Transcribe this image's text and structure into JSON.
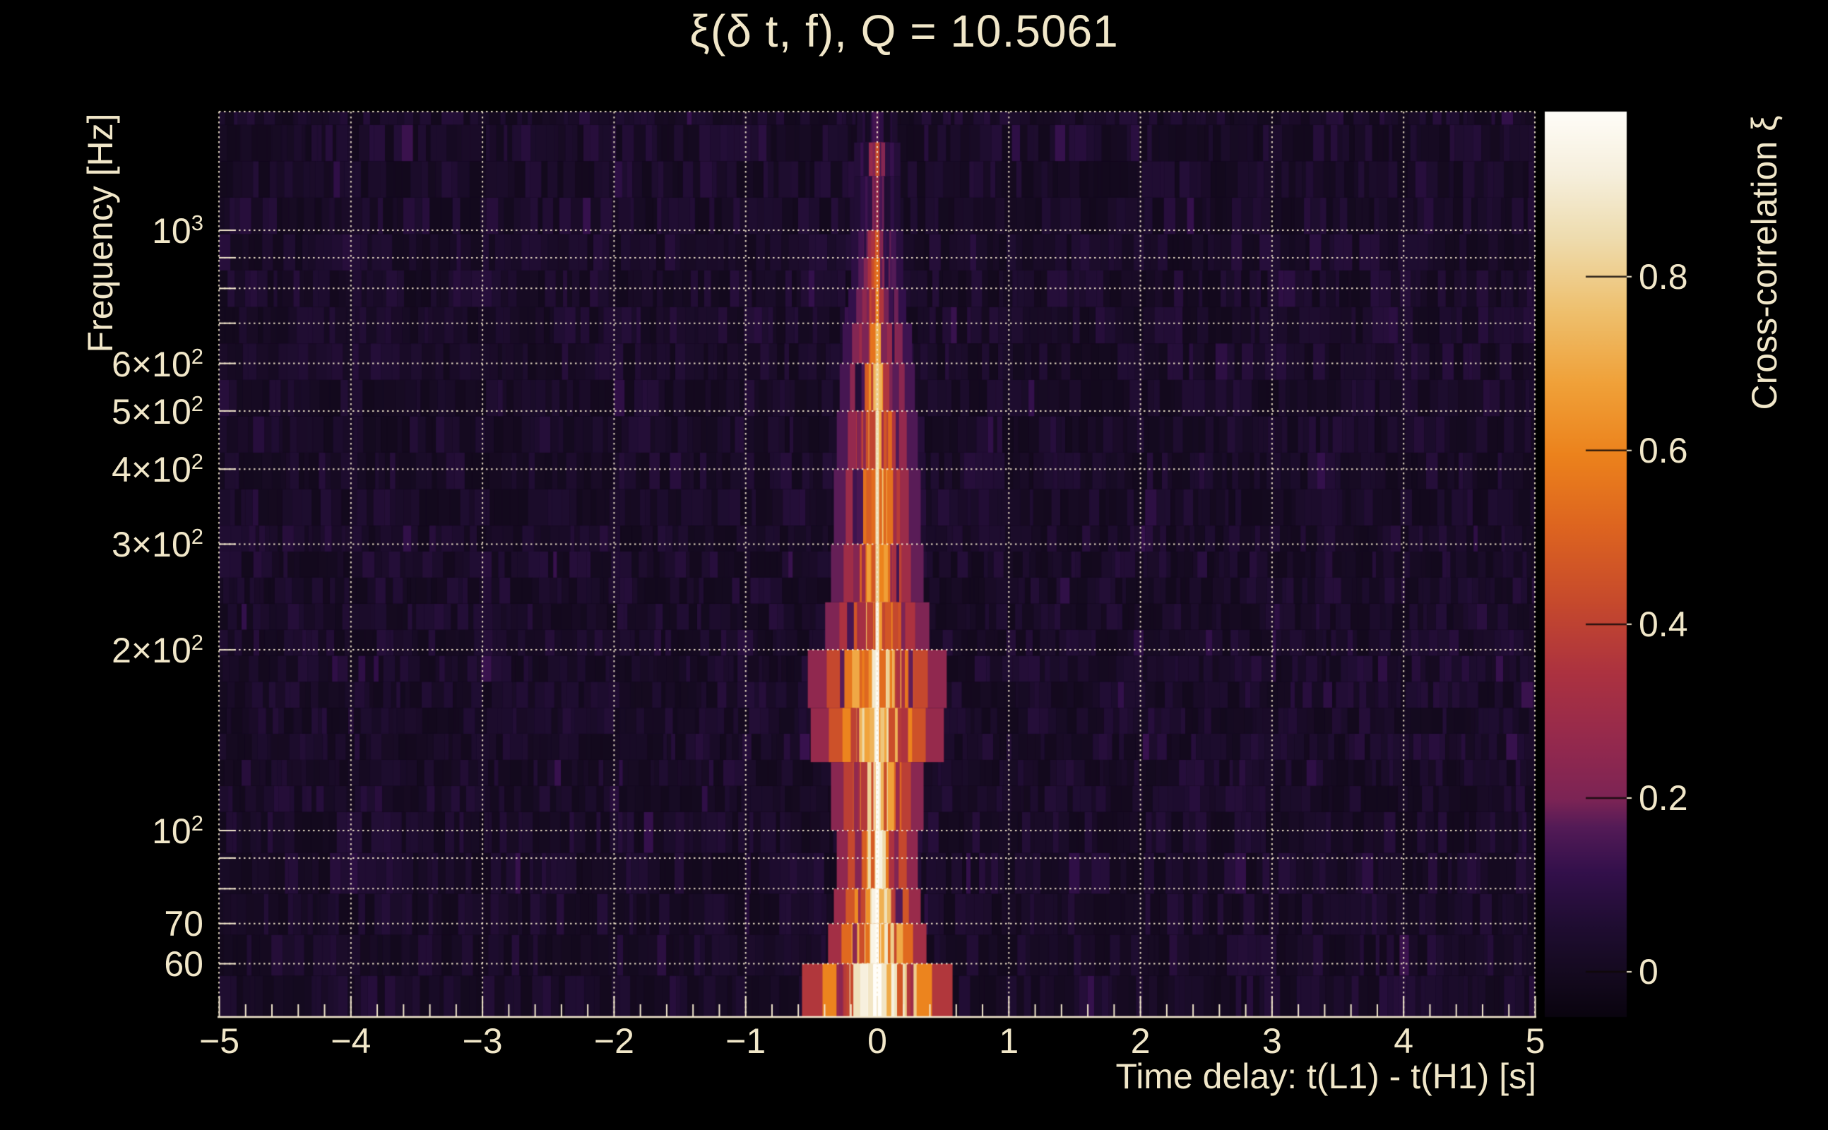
{
  "header": {
    "title": "ξ(δ t, f), Q = 10.5061"
  },
  "y_axis": {
    "title": "Frequency [Hz]",
    "tick_labels": [
      {
        "f": 1000,
        "main": "10",
        "sup": "3"
      },
      {
        "f": 600,
        "main": "6×10",
        "sup": "2"
      },
      {
        "f": 500,
        "main": "5×10",
        "sup": "2"
      },
      {
        "f": 400,
        "main": "4×10",
        "sup": "2"
      },
      {
        "f": 300,
        "main": "3×10",
        "sup": "2"
      },
      {
        "f": 200,
        "main": "2×10",
        "sup": "2"
      },
      {
        "f": 100,
        "main": "10",
        "sup": "2"
      },
      {
        "f": 70,
        "main": "70",
        "sup": ""
      },
      {
        "f": 60,
        "main": "60",
        "sup": ""
      }
    ]
  },
  "x_axis": {
    "title": "Time delay: t(L1) - t(H1) [s]",
    "tick_labels": [
      {
        "t": -5,
        "text": "−5"
      },
      {
        "t": -4,
        "text": "−4"
      },
      {
        "t": -3,
        "text": "−3"
      },
      {
        "t": -2,
        "text": "−2"
      },
      {
        "t": -1,
        "text": "−1"
      },
      {
        "t": 0,
        "text": "0"
      },
      {
        "t": 1,
        "text": "1"
      },
      {
        "t": 2,
        "text": "2"
      },
      {
        "t": 3,
        "text": "3"
      },
      {
        "t": 4,
        "text": "4"
      },
      {
        "t": 5,
        "text": "5"
      }
    ]
  },
  "colorbar": {
    "title": "Cross-correlation ξ",
    "tick_labels": [
      {
        "v": 0.8,
        "text": "0.8"
      },
      {
        "v": 0.6,
        "text": "0.6"
      },
      {
        "v": 0.4,
        "text": "0.4"
      },
      {
        "v": 0.2,
        "text": "0.2"
      },
      {
        "v": 0.0,
        "text": "0"
      }
    ],
    "value_min": -0.052,
    "value_max": 0.99,
    "colormap_stops": [
      [
        0.0,
        "#0a040f"
      ],
      [
        0.05,
        "#150a20"
      ],
      [
        0.1,
        "#1f0d31"
      ],
      [
        0.16,
        "#33104b"
      ],
      [
        0.21,
        "#541b57"
      ],
      [
        0.24,
        "#7c2455"
      ],
      [
        0.3,
        "#93294e"
      ],
      [
        0.38,
        "#ac3240"
      ],
      [
        0.46,
        "#c74a2c"
      ],
      [
        0.54,
        "#dd6420"
      ],
      [
        0.62,
        "#ec821c"
      ],
      [
        0.7,
        "#f0a139"
      ],
      [
        0.78,
        "#eec06e"
      ],
      [
        0.86,
        "#eedcae"
      ],
      [
        0.93,
        "#f6efdc"
      ],
      [
        1.0,
        "#fffdf8"
      ]
    ]
  },
  "style_colors": {
    "text_cream": "#f1e7c9",
    "grid_cream": "#f3e8cd",
    "background": "#000000"
  },
  "chart_data": {
    "type": "heatmap",
    "title": "ξ(δ t, f), Q = 10.5061",
    "xlabel": "Time delay: t(L1) - t(H1) [s]",
    "ylabel": "Frequency [Hz]",
    "colorbar_label": "Cross-correlation ξ",
    "x_range": [
      -5,
      5
    ],
    "x_major_ticks": [
      -5,
      -4,
      -3,
      -2,
      -1,
      0,
      1,
      2,
      3,
      4,
      5
    ],
    "x_minor_step": 0.2,
    "x_gridlines": [
      -4,
      -3,
      -2,
      -1,
      0,
      1,
      2,
      3,
      4
    ],
    "y_scale": "log",
    "y_range_hz": [
      49,
      1580
    ],
    "y_grid_hz": [
      60,
      70,
      80,
      90,
      100,
      200,
      300,
      400,
      500,
      600,
      700,
      800,
      900,
      1000
    ],
    "y_labeled_ticks_hz": [
      1000,
      600,
      500,
      400,
      300,
      200,
      100,
      70,
      60
    ],
    "grid_style": "dotted",
    "legend_position": "right-colorbar",
    "color_range": [
      -0.052,
      0.99
    ],
    "colorbar_ticks": [
      0,
      0.2,
      0.4,
      0.6,
      0.8
    ],
    "noise_floor_xi": [
      -0.02,
      0.1
    ],
    "ridge": {
      "delay_s": 0.0,
      "peak_xi": 0.99,
      "profile": [
        {
          "f_lo": 1400,
          "f_hi": 1580,
          "core_xi": 0.16,
          "halo_xi": 0.1,
          "halo_halfwidth_s": 0.07
        },
        {
          "f_lo": 1230,
          "f_hi": 1400,
          "core_xi": 0.44,
          "halo_xi": 0.16,
          "halo_halfwidth_s": 0.08
        },
        {
          "f_lo": 1000,
          "f_hi": 1230,
          "core_xi": 0.27,
          "halo_xi": 0.13,
          "halo_halfwidth_s": 0.08
        },
        {
          "f_lo": 900,
          "f_hi": 1000,
          "core_xi": 0.48,
          "halo_xi": 0.18,
          "halo_halfwidth_s": 0.09
        },
        {
          "f_lo": 800,
          "f_hi": 900,
          "core_xi": 0.55,
          "halo_xi": 0.22,
          "halo_halfwidth_s": 0.09
        },
        {
          "f_lo": 700,
          "f_hi": 800,
          "core_xi": 0.62,
          "halo_xi": 0.25,
          "halo_halfwidth_s": 0.1
        },
        {
          "f_lo": 600,
          "f_hi": 700,
          "core_xi": 0.74,
          "halo_xi": 0.29,
          "halo_halfwidth_s": 0.12
        },
        {
          "f_lo": 500,
          "f_hi": 600,
          "core_xi": 0.8,
          "halo_xi": 0.32,
          "halo_halfwidth_s": 0.13
        },
        {
          "f_lo": 400,
          "f_hi": 500,
          "core_xi": 0.85,
          "halo_xi": 0.35,
          "halo_halfwidth_s": 0.14
        },
        {
          "f_lo": 300,
          "f_hi": 400,
          "core_xi": 0.86,
          "halo_xi": 0.38,
          "halo_halfwidth_s": 0.15
        },
        {
          "f_lo": 240,
          "f_hi": 300,
          "core_xi": 0.82,
          "halo_xi": 0.4,
          "halo_halfwidth_s": 0.16
        },
        {
          "f_lo": 200,
          "f_hi": 240,
          "core_xi": 0.9,
          "halo_xi": 0.46,
          "halo_halfwidth_s": 0.18
        },
        {
          "f_lo": 160,
          "f_hi": 200,
          "core_xi": 0.95,
          "halo_xi": 0.56,
          "halo_halfwidth_s": 0.24
        },
        {
          "f_lo": 130,
          "f_hi": 160,
          "core_xi": 0.96,
          "halo_xi": 0.6,
          "halo_halfwidth_s": 0.23
        },
        {
          "f_lo": 100,
          "f_hi": 130,
          "core_xi": 0.97,
          "halo_xi": 0.52,
          "halo_halfwidth_s": 0.16
        },
        {
          "f_lo": 80,
          "f_hi": 100,
          "core_xi": 0.99,
          "halo_xi": 0.56,
          "halo_halfwidth_s": 0.14
        },
        {
          "f_lo": 70,
          "f_hi": 80,
          "core_xi": 0.99,
          "halo_xi": 0.62,
          "halo_halfwidth_s": 0.15
        },
        {
          "f_lo": 60,
          "f_hi": 70,
          "core_xi": 0.99,
          "halo_xi": 0.7,
          "halo_halfwidth_s": 0.17
        },
        {
          "f_lo": 49,
          "f_hi": 60,
          "core_xi": 0.99,
          "halo_xi": 0.8,
          "halo_halfwidth_s": 0.26
        }
      ]
    }
  }
}
